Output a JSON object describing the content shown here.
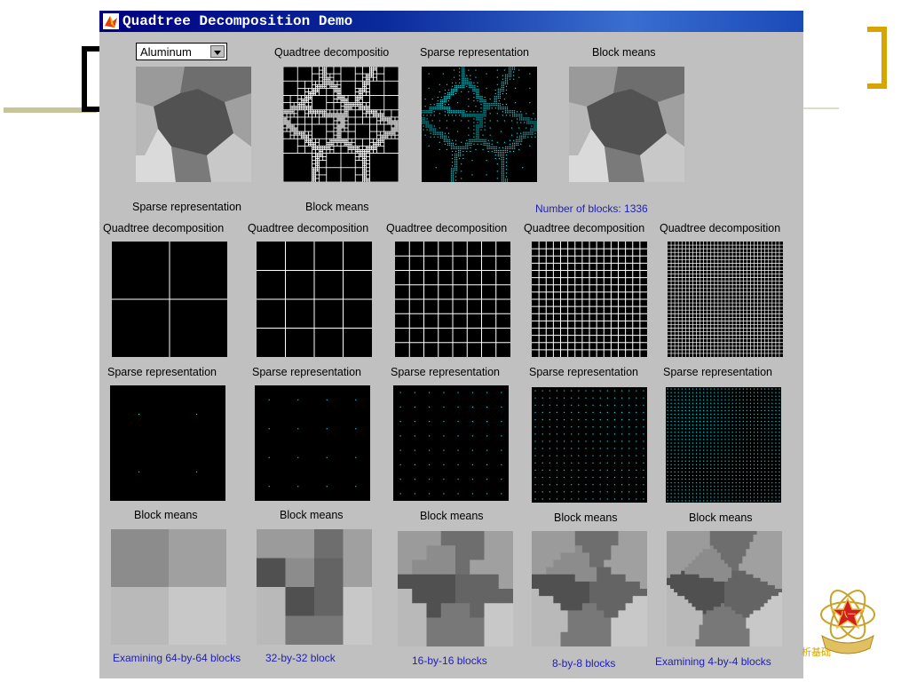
{
  "window": {
    "title": "Quadtree Decomposition Demo"
  },
  "image_select": {
    "value": "Aluminum"
  },
  "top_row": {
    "headers": [
      "Quadtree decompositio",
      "Sparse representation",
      "Block means"
    ],
    "under_labels": [
      "Sparse representation",
      "Block means"
    ],
    "block_count": "Number of blocks: 1336"
  },
  "grid": {
    "quadtree_label": "Quadtree decomposition",
    "sparse_label": "Sparse representation",
    "means_label": "Block means",
    "captions": [
      "Examining 64-by-64  blocks",
      "32-by-32 block",
      "16-by-16 blocks",
      "8-by-8 blocks",
      "Examining 4-by-4 blocks"
    ],
    "levels": [
      2,
      4,
      8,
      16,
      32
    ]
  },
  "colors": {
    "title_bar": "#000080",
    "window_bg": "#c0c0c0",
    "caption_blue": "#1e1eb4",
    "sparse_dot": "#00d8e0",
    "accent_gold": "#d7a500"
  },
  "slide": {
    "corner_text": "析基础"
  }
}
